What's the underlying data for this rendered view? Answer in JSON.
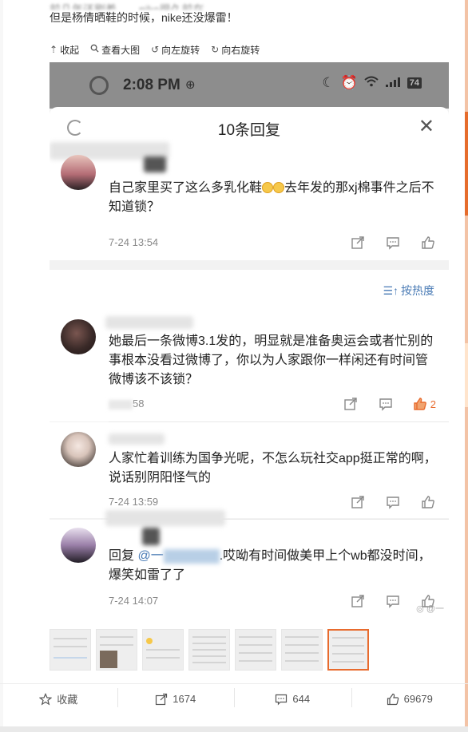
{
  "post": {
    "line1_faded": "前几年还刷着……nike很久前在……",
    "line2": "但是杨倩晒鞋的时候，nike还没爆雷！"
  },
  "toolbar": {
    "collapse": "收起",
    "view_large": "查看大图",
    "rotate_left": "向左旋转",
    "rotate_right": "向右旋转"
  },
  "phone_status": {
    "time": "2:08 PM",
    "battery": "74"
  },
  "reply_panel": {
    "title": "10条回复",
    "sort_label": "按热度"
  },
  "comments": [
    {
      "text": "自己家里买了这么多乳化鞋",
      "text_after": "去年发的那xj棉事件之后不知道锁？",
      "time": "7-24 13:54",
      "likes": ""
    },
    {
      "text": "她最后一条微博3.1发的，明显就是准备奥运会或者忙别的事根本没看过微博了，你以为人家跟你一样闲还有时间管微博该不该锁？",
      "time": "58",
      "likes": "2"
    },
    {
      "text": "人家忙着训练为国争光呢，不怎么玩社交app挺正常的啊，说话别阴阳怪气的",
      "time": "7-24 13:59",
      "likes": ""
    },
    {
      "text_prefix": "回复",
      "mention": "@一",
      "text": ".哎呦有时间做美甲上个wb都没时间，爆笑如雷了了",
      "time": "7-24 14:07",
      "likes": ""
    }
  ],
  "watermark": "@一",
  "bottom_bar": {
    "favorite_label": "收藏",
    "repost_count": "1674",
    "comment_count": "644",
    "like_count": "69679"
  }
}
